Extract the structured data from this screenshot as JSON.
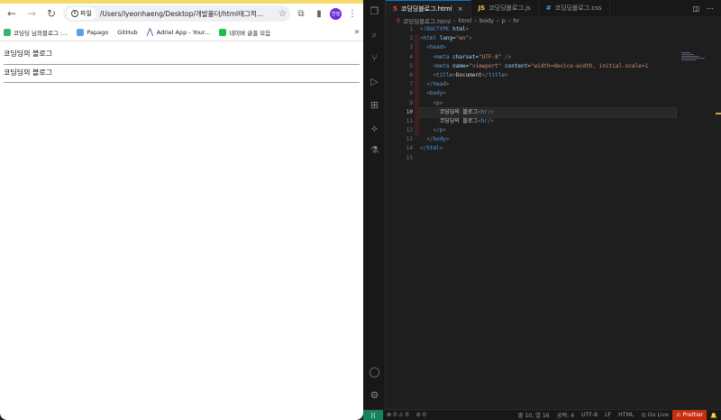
{
  "browser": {
    "nav": {
      "back_icon": "arrow-left-icon",
      "forward_icon": "arrow-right-icon",
      "reload_icon": "reload-icon"
    },
    "omnibox": {
      "chip_label": "파일",
      "url": "/Users/lyeonhaeng/Desktop/개발폴더/html태그적..."
    },
    "avatar_label": "연행",
    "bookmarks": [
      {
        "label": "코딩딩 님의블로그 :..."
      },
      {
        "label": "Papago"
      },
      {
        "label": "GitHub"
      },
      {
        "label": "Adriel App - Your..."
      },
      {
        "label": "네이버 글꼴 모음"
      }
    ],
    "bookmarks_more": "»",
    "page": {
      "line1": "코딩딩의 블로그",
      "line2": "코딩딩의 블로그"
    }
  },
  "vscode": {
    "tabs": [
      {
        "icon": "5",
        "label": "코딩딩블로그.html",
        "close": "×"
      },
      {
        "icon": "JS",
        "label": "코딩딩블로그.js"
      },
      {
        "icon": "#",
        "label": "코딩딩블로그.css"
      }
    ],
    "tab_actions": [
      "split-editor-icon",
      "more-icon"
    ],
    "breadcrumb": [
      "코딩딩블로그.html",
      "html",
      "body",
      "p",
      "hr"
    ],
    "line_numbers": [
      "1",
      "2",
      "3",
      "4",
      "5",
      "6",
      "7",
      "8",
      "9",
      "10",
      "11",
      "12",
      "13",
      "14",
      "15"
    ],
    "current_line": "10",
    "status": {
      "errors": "0",
      "warnings": "0",
      "ports": "0",
      "position": "줄 10, 열 16",
      "spaces": "공백: 4",
      "encoding": "UTF-8",
      "eol": "LF",
      "language": "HTML",
      "golive": "Go Live",
      "prettier": "Prettier"
    }
  },
  "colors": {
    "browser_top_accent": "#f6d96b",
    "vscode_bg": "#1e1e1e",
    "status_remote": "#16825d",
    "prettier_bg": "#c72e0f",
    "avatar": "#6c2bd9"
  }
}
